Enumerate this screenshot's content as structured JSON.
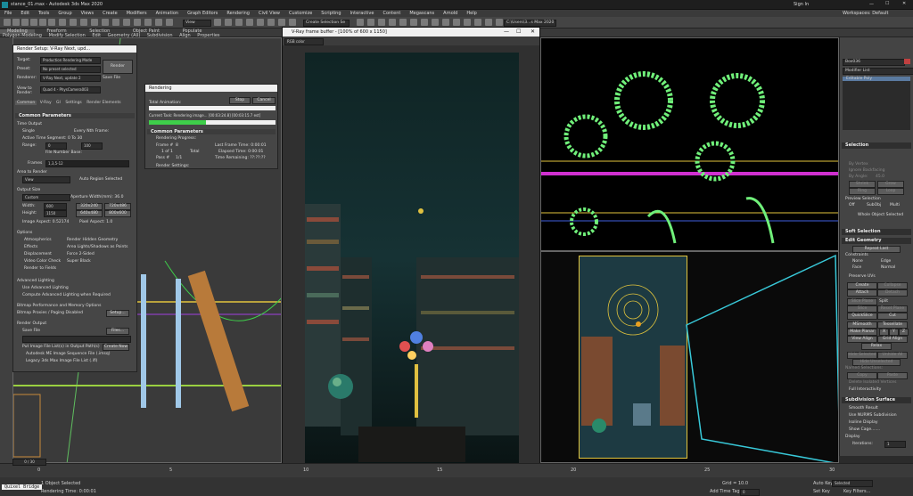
{
  "window": {
    "title": "stance_01.max - Autodesk 3ds Max 2020",
    "signin": "Sign In",
    "workspaces": "Workspaces:  Default"
  },
  "menu": [
    "File",
    "Edit",
    "Tools",
    "Group",
    "Views",
    "Create",
    "Modifiers",
    "Animation",
    "Graph Editors",
    "Rendering",
    "Civil View",
    "Customize",
    "Scripting",
    "Interactive",
    "Content",
    "Megascans",
    "Arnold",
    "Help"
  ],
  "toolbar": {
    "view_dropdown": "View",
    "selection_set": "Create Selection Se",
    "path": "C:\\Users\\3...s Max 2020"
  },
  "ribbon": {
    "tabs": [
      "Modeling",
      "Freeform",
      "Selection",
      "Object Paint",
      "Populate"
    ],
    "subtabs": [
      "Polygon Modeling",
      "Modify Selection",
      "Edit",
      "Geometry (All)",
      "Subdivision",
      "Align",
      "Properties"
    ]
  },
  "render_setup": {
    "title": "Render Setup: V-Ray Next, upd...",
    "target_label": "Target:",
    "target_value": "Production Rendering Mode",
    "preset_label": "Preset:",
    "preset_value": "No preset selected",
    "renderer_label": "Renderer:",
    "renderer_value": "V-Ray Next, update 2",
    "save_file": "Save File",
    "view_label": "View to Render:",
    "view_value": "Quad 4 - PhysCamera003",
    "render_button": "Render",
    "tabs": [
      "Common",
      "V-Ray",
      "GI",
      "Settings",
      "Render Elements"
    ],
    "common_params": "Common Parameters",
    "time_output": "Time Output",
    "single": "Single",
    "every_nth": "Every Nth Frame:",
    "active_time": "Active Time Segment:  0 To 30",
    "range": "Range:",
    "range_from": "0",
    "range_to": "100",
    "file_number_base": "File Number Base:",
    "frames_label": "Frames",
    "frames_value": "1,3,5-12",
    "area_to_render": "Area to Render",
    "area_value": "View",
    "auto_region": "Auto Region Selected",
    "output_size": "Output Size",
    "output_custom": "Custom",
    "aperture": "Aperture Width(mm): 36.0",
    "width_label": "Width:",
    "width_value": "600",
    "height_label": "Height:",
    "height_value": "1150",
    "presets": [
      "320x240",
      "720x486",
      "640x480",
      "800x600"
    ],
    "image_aspect": "Image Aspect: 0.52174",
    "pixel_aspect": "Pixel Aspect: 1.0",
    "options": "Options",
    "opt_left": [
      "Atmospherics",
      "Effects",
      "Displacement",
      "Video Color Check",
      "Render to Fields"
    ],
    "opt_right": [
      "Render Hidden Geometry",
      "Area Lights/Shadows as Points",
      "Force 2-Sided",
      "Super Black"
    ],
    "adv_lighting": "Advanced Lighting",
    "use_adv": "Use Advanced Lighting",
    "compute_adv": "Compute Advanced Lighting when Required",
    "bitmap_perf": "Bitmap Performance and Memory Options",
    "bitmap_proxies": "Bitmap Proxies / Paging Disabled",
    "setup": "Setup...",
    "render_output": "Render Output",
    "save_file2": "Save File",
    "files": "Files...",
    "put_image": "Put Image File List(s) in Output Path(s)",
    "create_now": "Create Now",
    "autodesk_seq": "Autodesk ME Image Sequence File (.imsq)",
    "legacy": "Legacy 3ds Max Image File List (.ifl)"
  },
  "rendering_dialog": {
    "title": "Rendering",
    "total_animation": "Total Animation:",
    "stop": "Stop",
    "cancel": "Cancel",
    "current_task": "Current Task:   Rendering image... [00:03:24.8] [00:03:15.7 est]",
    "common_params": "Common Parameters",
    "rendering_progress": "Rendering Progress:",
    "frame_label": "Frame #",
    "frame_value": "8",
    "of_label": "1 of 1",
    "total": "Total",
    "pass_label": "Pass #",
    "pass_value": "1/1",
    "last_frame_time": "Last Frame Time:  0:00:01",
    "elapsed_time": "Elapsed Time:  0:00:01",
    "time_remaining": "Time Remaining:  ??:??:??",
    "render_settings": "Render Settings:"
  },
  "vfb": {
    "title": "V-Ray frame buffer - [100% of 600 x 1150]",
    "channel": "RGB color",
    "status": "Rendering image... [00:03:24.8] [00:03:15.7 est]"
  },
  "command_panel": {
    "object_name": "Box036",
    "modifier_list": "Modifier List",
    "stack_item": "Editable Poly",
    "selection": "Selection",
    "by_vertex": "By Vertex",
    "ignore_backfacing": "Ignore Backfacing",
    "by_angle": "By Angle:",
    "angle_value": "45.0",
    "shrink": "Shrink",
    "grow": "Grow",
    "ring": "Ring",
    "loop": "Loop",
    "preview_selection": "Preview Selection",
    "off": "Off",
    "subobj": "SubObj",
    "multi": "Multi",
    "whole_object": "Whole Object Selected",
    "soft_selection": "Soft Selection",
    "edit_geometry": "Edit Geometry",
    "repeat_last": "Repeat Last",
    "constraints": "Constraints",
    "none": "None",
    "edge": "Edge",
    "face": "Face",
    "normal": "Normal",
    "preserve_uvs": "Preserve UVs",
    "create": "Create",
    "collapse": "Collapse",
    "attach": "Attach",
    "detach": "Detach",
    "slice_plane": "Slice Plane",
    "split": "Split",
    "slice": "Slice",
    "reset_plane": "Reset Plane",
    "quickslice": "QuickSlice",
    "cut": "Cut",
    "msmooth": "MSmooth",
    "tessellate": "Tessellate",
    "make_planar": "Make Planar",
    "x": "X",
    "y": "Y",
    "z": "Z",
    "view_align": "View Align",
    "grid_align": "Grid Align",
    "relax": "Relax",
    "hide_selected": "Hide Selected",
    "unhide_all": "Unhide All",
    "hide_unselected": "Hide Unselected",
    "named_selections": "Named Selections:",
    "copy": "Copy",
    "paste": "Paste",
    "delete_isolated": "Delete Isolated Vertices",
    "full_interactivity": "Full Interactivity",
    "subdivision_surface": "Subdivision Surface",
    "smooth_result": "Smooth Result",
    "use_nurms": "Use NURMS Subdivision",
    "isoline": "Isoline Display",
    "show_cage": "Show Cage.......",
    "display": "Display",
    "iterations": "Iterations:",
    "iter_value": "1"
  },
  "timeline": {
    "frame_counter": "0 / 30",
    "ticks": [
      "0",
      "5",
      "10",
      "15",
      "20",
      "25",
      "30"
    ]
  },
  "status": {
    "script": "Quixel Bridge",
    "objects": "1 Object Selected",
    "render_time": "Rendering Time: 0:00:01",
    "grid": "Grid = 10.0",
    "add_time_tag": "Add Time Tag",
    "auto_key": "Auto Key",
    "selected": "Selected",
    "set_key": "Set Key",
    "key_filters": "Key Filters...",
    "frame_field": "0"
  },
  "colors": {
    "bg": "#2b2b2b",
    "accent": "#4a8bd8",
    "vray_green": "#3ecf4a",
    "viewport_yellow": "#e2c43c",
    "cyan": "#38c8d8"
  }
}
